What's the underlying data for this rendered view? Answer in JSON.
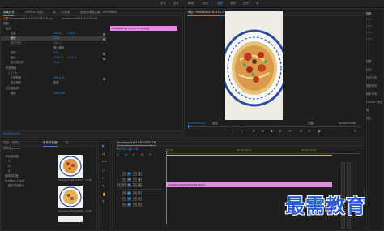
{
  "topbar": {
    "workspaces": [
      "学习",
      "组件",
      "编辑",
      "颜色",
      "效果",
      "音频",
      "图形",
      "库"
    ]
  },
  "effect_controls": {
    "tabs": [
      "效果控件",
      "Lumetri 范围",
      "源：（无剪辑）",
      "音频剪辑混合器：mmexport"
    ],
    "source_label": "主要 * mmexport1615307235728.jpg",
    "clip_label": "mmexport1615307235728...",
    "clip_bar_label": "mmexport1615307235728.jpg",
    "sections": {
      "video": "视频",
      "motion": "运动",
      "position": "位置",
      "scale": "缩放",
      "scale_width": "缩放宽度",
      "uniform": "等比缩放",
      "rotation": "旋转",
      "anchor": "锚点",
      "anti_flicker": "防闪烁滤镜",
      "opacity": "不透明度",
      "opacity_val": "不透明度",
      "blend": "混合模式",
      "blend_val": "正常",
      "time_remap": "时间重映射",
      "speed": "速度"
    },
    "values": {
      "pos_x": "240.0",
      "pos_y": "135.0",
      "scale": "23.0",
      "scale_width": "100.0",
      "rotation": "0.0",
      "anchor_x": "1080.0",
      "anchor_y": "1440.0",
      "flicker": "0.00",
      "opacity": "100.0 %",
      "speed": "100.00%"
    },
    "timecode": "00:00:00:00"
  },
  "program": {
    "tab": "节目：mmexport1615307235728",
    "timecode": "00:00:00:00",
    "fit": "适合",
    "quality": "完整",
    "duration": "00:00:05:00"
  },
  "project": {
    "tabs": [
      "项目：未命名",
      "媒体浏览器",
      "库"
    ],
    "breadcrumb": "未命名.prproj",
    "tree": [
      "本地驱动器",
      "C:",
      "D:",
      "E:",
      "网络驱动器",
      "Creative Cloud",
      "团队项目版本"
    ],
    "items": [
      {
        "name": "mmexport16153072...",
        "duration": "5:00"
      },
      {
        "name": "mmexport16153072...",
        "duration": "5:00"
      }
    ]
  },
  "timeline": {
    "tab": "mmexport1615307235728",
    "timecode": "00:00:00:00",
    "ruler": [
      "00:00",
      "00:00:05:00",
      "00:00:10:00"
    ],
    "tracks": [
      "V3",
      "V2",
      "V1",
      "A1",
      "A2",
      "A3"
    ],
    "clip": "mmexport1615307235728.jpg"
  },
  "right_panel": {
    "items": [
      "信息",
      "效果",
      "标记",
      "历史记录",
      "基本图形",
      "基本声音",
      "Lumetri 颜色",
      "库",
      "项目"
    ]
  },
  "watermark": "最需教育"
}
